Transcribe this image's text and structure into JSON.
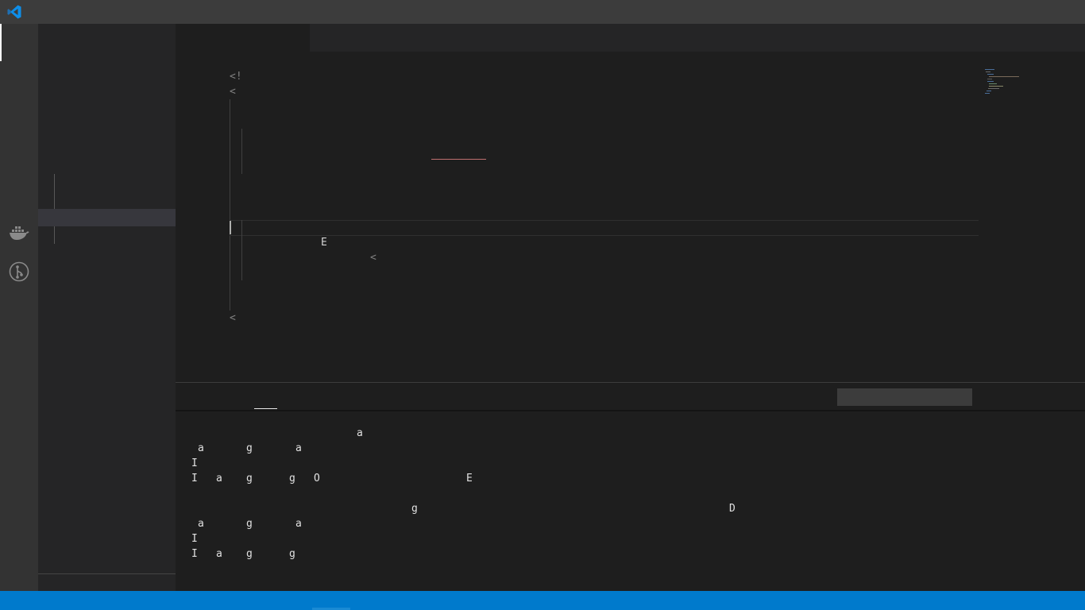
{
  "colors": {
    "accent": "#007acc",
    "titlebar_bg": "#3c3c3c",
    "activitybar_bg": "#333333",
    "sidebar_bg": "#252526",
    "editor_bg": "#1e1e1e"
  },
  "icons": {
    "app": "vscode-logo-icon",
    "docker": "docker-icon",
    "git": "git-graph-icon"
  },
  "editor": {
    "lines": [
      "<!",
      "<",
      "E",
      "<",
      "<"
    ]
  },
  "panel": {
    "filter_placeholder": "",
    "terminal_glyphs": [
      "a",
      "a",
      "g",
      "a",
      "I",
      "I",
      "a",
      "g",
      "g",
      "O",
      "E",
      "g",
      "D",
      "a",
      "g",
      "a",
      "I",
      "I",
      "a",
      "g",
      "g"
    ]
  }
}
